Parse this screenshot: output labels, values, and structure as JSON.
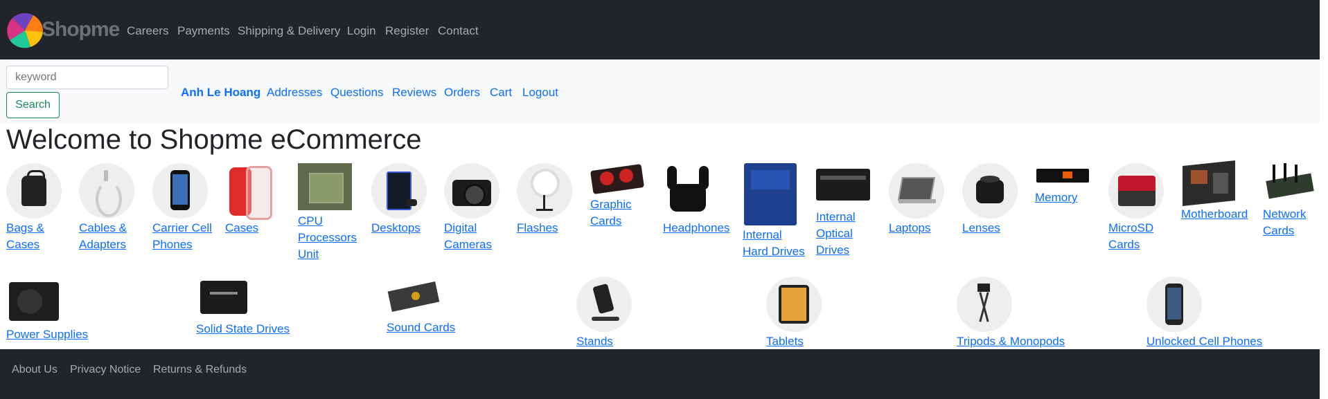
{
  "brand": {
    "name": "Shopme"
  },
  "topnav": {
    "links": [
      "Careers",
      "Payments",
      "Shipping & Delivery",
      "Login",
      "Register",
      "Contact"
    ]
  },
  "search": {
    "placeholder": "keyword",
    "button_label": "Search"
  },
  "user_nav": {
    "user_name": "Anh Le Hoang",
    "links": [
      "Addresses",
      "Questions",
      "Reviews",
      "Orders",
      "Cart",
      "Logout"
    ]
  },
  "main": {
    "heading": "Welcome to Shopme eCommerce"
  },
  "categories": [
    {
      "label": "Bags & Cases",
      "icon": "bag-icon"
    },
    {
      "label": "Cables & Adapters",
      "icon": "cable-icon"
    },
    {
      "label": "Carrier Cell Phones",
      "icon": "phone-icon"
    },
    {
      "label": "Cases",
      "icon": "phone-case-icon"
    },
    {
      "label": "CPU Processors Unit",
      "icon": "cpu-icon"
    },
    {
      "label": "Desktops",
      "icon": "desktop-icon"
    },
    {
      "label": "Digital Cameras",
      "icon": "camera-icon"
    },
    {
      "label": "Flashes",
      "icon": "ring-light-icon"
    },
    {
      "label": "Graphic Cards",
      "icon": "graphics-card-icon"
    },
    {
      "label": "Headphones",
      "icon": "earbuds-icon"
    },
    {
      "label": "Internal Hard Drives",
      "icon": "hard-drive-icon"
    },
    {
      "label": "Internal Optical Drives",
      "icon": "optical-drive-icon"
    },
    {
      "label": "Laptops",
      "icon": "laptop-icon"
    },
    {
      "label": "Lenses",
      "icon": "lens-icon"
    },
    {
      "label": "Memory",
      "icon": "memory-icon"
    },
    {
      "label": "MicroSD Cards",
      "icon": "sd-card-icon"
    },
    {
      "label": "Motherboard",
      "icon": "motherboard-icon"
    },
    {
      "label": "Network Cards",
      "icon": "network-card-icon"
    },
    {
      "label": "Power Supplies",
      "icon": "power-supply-icon"
    },
    {
      "label": "Solid State Drives",
      "icon": "ssd-icon"
    },
    {
      "label": "Sound Cards",
      "icon": "sound-card-icon"
    },
    {
      "label": "Stands",
      "icon": "stand-icon"
    },
    {
      "label": "Tablets",
      "icon": "tablet-icon"
    },
    {
      "label": "Tripods & Monopods",
      "icon": "tripod-icon"
    },
    {
      "label": "Unlocked Cell Phones",
      "icon": "smartphone-icon"
    }
  ],
  "footer": {
    "links": [
      "About Us",
      "Privacy Notice",
      "Returns & Refunds"
    ]
  },
  "colors": {
    "nav_bg": "#212529",
    "link": "#0d6efd",
    "search_button": "#198754",
    "subbar_bg": "#f8f9fa"
  }
}
